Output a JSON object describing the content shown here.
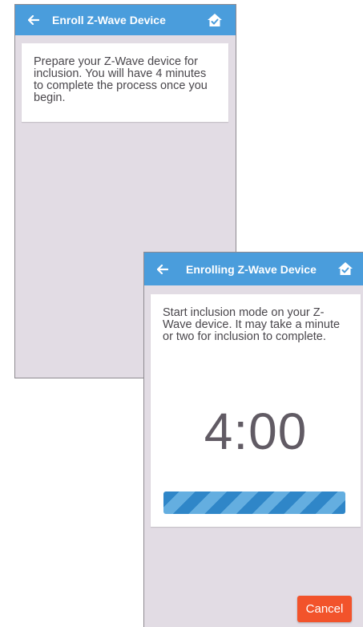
{
  "colors": {
    "appbar": "#4a9ddc",
    "background": "#e2dce4",
    "cancel_button": "#f2532b",
    "progress_dark": "#2f86c8",
    "progress_light": "#64aee0"
  },
  "enroll_screen": {
    "title": "Enroll Z-Wave Device",
    "back_icon": "arrow-left-icon",
    "home_icon": "home-check-icon",
    "message": "Prepare your Z-Wave device for inclusion. You will have 4 minutes to complete the process once you begin."
  },
  "enrolling_screen": {
    "title": "Enrolling Z-Wave Device",
    "back_icon": "arrow-left-icon",
    "home_icon": "home-check-icon",
    "message": "Start inclusion mode on your Z-Wave device. It may take a minute or two for inclusion to complete.",
    "timer": "4:00",
    "progress_fraction": 1.0,
    "cancel_label": "Cancel"
  }
}
